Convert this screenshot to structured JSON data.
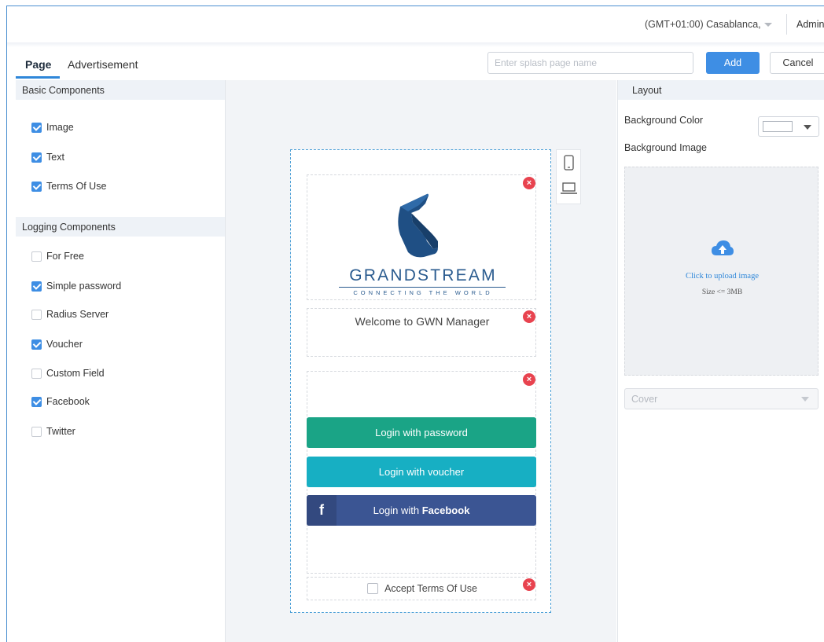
{
  "topbar": {
    "timezone": "(GMT+01:00) Casablanca,",
    "user": "Admin"
  },
  "tabs": [
    {
      "label": "Page",
      "active": true
    },
    {
      "label": "Advertisement",
      "active": false
    }
  ],
  "toolbar": {
    "name_placeholder": "Enter splash page name",
    "name_value": "",
    "add_label": "Add",
    "cancel_label": "Cancel"
  },
  "left_panel": {
    "basic": {
      "title": "Basic Components",
      "items": [
        {
          "label": "Image",
          "checked": true
        },
        {
          "label": "Text",
          "checked": true
        },
        {
          "label": "Terms Of Use",
          "checked": true
        }
      ]
    },
    "logging": {
      "title": "Logging Components",
      "items": [
        {
          "label": "For Free",
          "checked": false
        },
        {
          "label": "Simple password",
          "checked": true
        },
        {
          "label": "Radius Server",
          "checked": false
        },
        {
          "label": "Voucher",
          "checked": true
        },
        {
          "label": "Custom Field",
          "checked": false
        },
        {
          "label": "Facebook",
          "checked": true
        },
        {
          "label": "Twitter",
          "checked": false
        }
      ]
    }
  },
  "preview": {
    "logo_word": "GRANDSTREAM",
    "logo_tagline": "CONNECTING THE WORLD",
    "welcome_text": "Welcome to GWN Manager",
    "login_password": "Login with password",
    "login_voucher": "Login with voucher",
    "login_facebook_prefix": "Login with ",
    "login_facebook_brand": "Facebook",
    "facebook_glyph": "f",
    "terms_label": "Accept Terms Of Use",
    "colors": {
      "password_btn": "#1aa486",
      "voucher_btn": "#17afc3",
      "facebook_btn": "#3b5593",
      "delete": "#e8434f",
      "brand_blue": "#2a5b8f"
    }
  },
  "right_panel": {
    "title": "Layout",
    "bg_color_label": "Background Color",
    "bg_color_value": "#ffffff",
    "bg_image_label": "Background Image",
    "upload_text": "Click to upload image",
    "upload_size": "Size <= 3MB",
    "fit_select": "Cover"
  },
  "icons": {
    "timezone_caret": "chevron-down-icon",
    "mobile": "mobile-device-icon",
    "desktop": "laptop-icon",
    "delete": "close-circle-icon",
    "upload": "cloud-upload-icon"
  }
}
